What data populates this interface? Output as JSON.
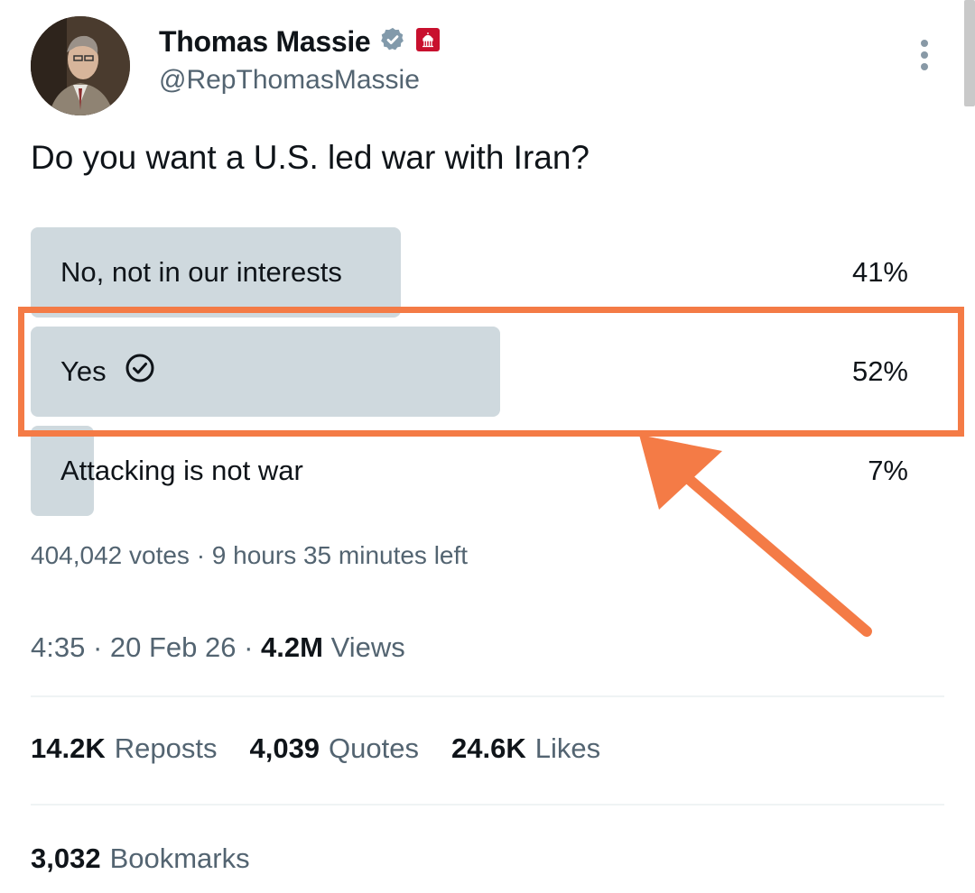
{
  "author": {
    "name": "Thomas Massie",
    "handle": "@RepThomasMassie",
    "verified_color": "#829aab",
    "gov_badge_color": "#c8102e"
  },
  "tweet": {
    "question": "Do you want a U.S. led war with Iran?"
  },
  "poll": {
    "options": [
      {
        "label": "No, not in our interests",
        "percent_text": "41%",
        "share": 0.41
      },
      {
        "label": "Yes",
        "percent_text": "52%",
        "share": 0.52,
        "selected_by_user": true
      },
      {
        "label": "Attacking is not war",
        "percent_text": "7%",
        "share": 0.07
      }
    ],
    "summary": "404,042 votes · 9 hours 35 minutes left"
  },
  "meta": {
    "time_date": "4:35 · 20 Feb 26 · ",
    "views_count": "4.2M",
    "views_label": " Views"
  },
  "stats": {
    "reposts_count": "14.2K",
    "reposts_label": "Reposts",
    "quotes_count": "4,039",
    "quotes_label": "Quotes",
    "likes_count": "24.6K",
    "likes_label": "Likes",
    "bookmarks_count": "3,032",
    "bookmarks_label": "Bookmarks"
  },
  "annotation": {
    "color": "#f47b46"
  }
}
